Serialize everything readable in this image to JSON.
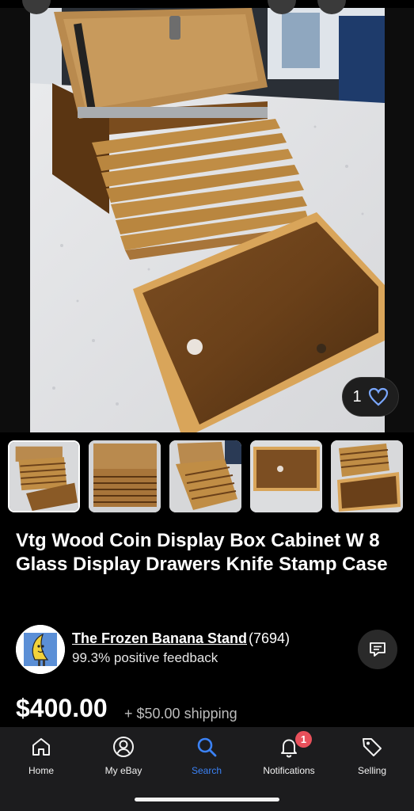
{
  "listing": {
    "title": "Vtg Wood Coin Display Box Cabinet W 8 Glass Display Drawers Knife Stamp Case",
    "price": "$400.00",
    "shipping": "+ $50.00 shipping",
    "watch_count": "1",
    "selected_image_index": 1,
    "image_count": 5,
    "main_image": "wood-coin-cabinet-photo"
  },
  "seller": {
    "name": "The Frozen Banana Stand",
    "feedback_count": "(7694)",
    "feedback": "99.3% positive feedback",
    "avatar": "frozen-banana-cartoon"
  },
  "thumbnails": [
    {
      "name": "cabinet-open-drawers"
    },
    {
      "name": "cabinet-front"
    },
    {
      "name": "cabinet-angle-drawers"
    },
    {
      "name": "glass-drawer"
    },
    {
      "name": "drawer-stack-and-tray"
    }
  ],
  "tabbar": {
    "items": [
      {
        "label": "Home",
        "icon": "home-icon",
        "active": false
      },
      {
        "label": "My eBay",
        "icon": "user-icon",
        "active": false
      },
      {
        "label": "Search",
        "icon": "search-icon",
        "active": true
      },
      {
        "label": "Notifications",
        "icon": "bell-icon",
        "active": false,
        "badge": "1"
      },
      {
        "label": "Selling",
        "icon": "tag-icon",
        "active": false
      }
    ]
  },
  "colors": {
    "background": "#000000",
    "tabbar": "#1c1c1e",
    "accent_active": "#3b82f6",
    "badge": "#e8505b",
    "wood": "#9a6a2e"
  }
}
